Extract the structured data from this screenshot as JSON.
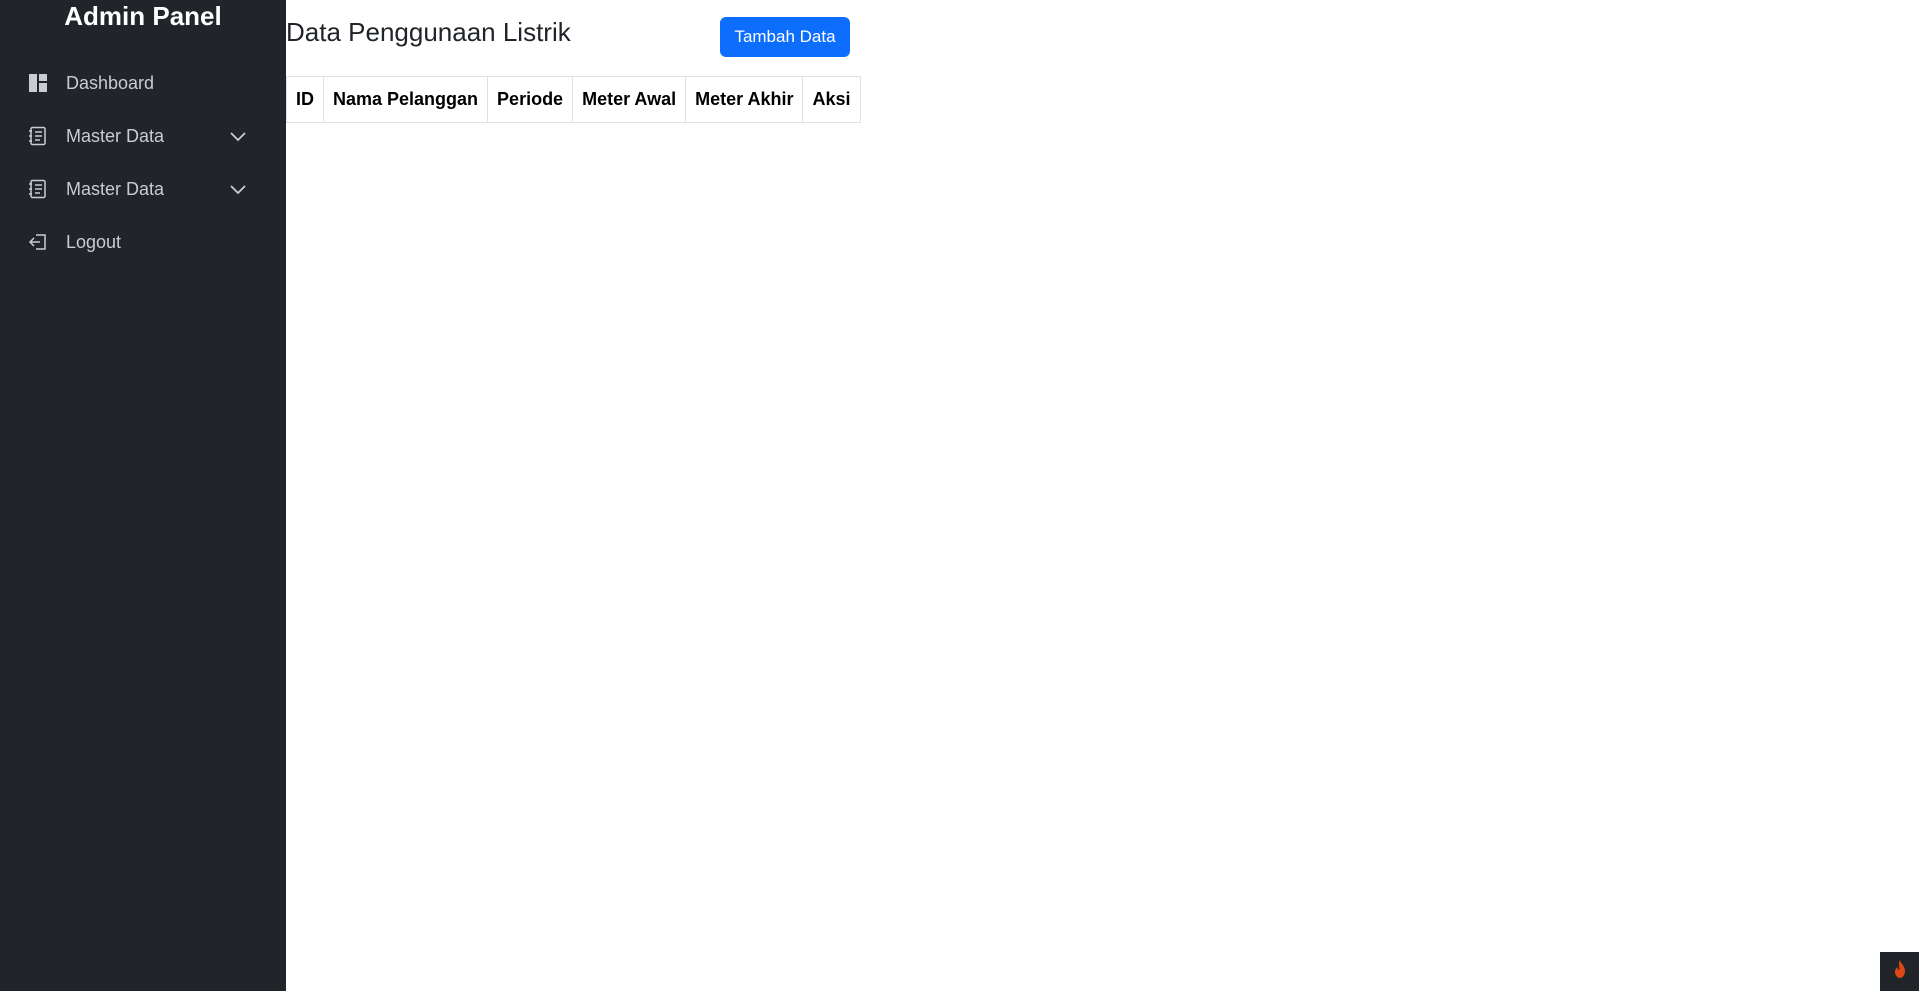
{
  "sidebar": {
    "brand": "Admin Panel",
    "items": [
      {
        "label": "Dashboard",
        "icon": "dashboard-icon"
      },
      {
        "label": "Master Data",
        "icon": "journal-icon",
        "expandable": true
      },
      {
        "label": "Master Data",
        "icon": "journal-icon",
        "expandable": true
      },
      {
        "label": "Logout",
        "icon": "logout-icon"
      }
    ]
  },
  "main": {
    "title": "Data Penggunaan Listrik",
    "add_button": "Tambah Data",
    "table": {
      "columns": [
        "ID",
        "Nama Pelanggan",
        "Periode",
        "Meter Awal",
        "Meter Akhir",
        "Aksi"
      ],
      "rows": []
    }
  },
  "colors": {
    "sidebar_bg": "#212529",
    "primary": "#0d6efd",
    "debug_toolbar_accent": "#dd4814"
  }
}
